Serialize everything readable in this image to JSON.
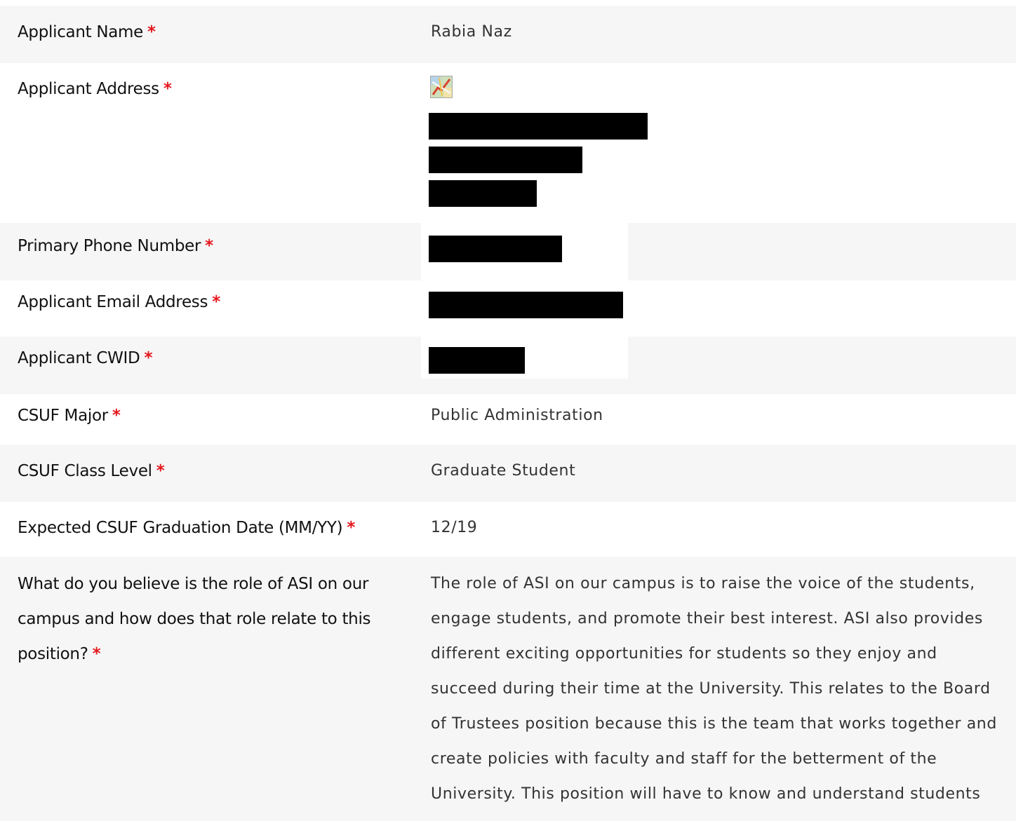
{
  "form": {
    "required_marker": "*",
    "fields": [
      {
        "label": "Applicant Name",
        "value": "Rabia Naz"
      },
      {
        "label": "Applicant Address",
        "value": ""
      },
      {
        "label": "Primary Phone Number",
        "value": ""
      },
      {
        "label": "Applicant Email Address",
        "value": ""
      },
      {
        "label": "Applicant CWID",
        "value": ""
      },
      {
        "label": "CSUF Major",
        "value": "Public Administration"
      },
      {
        "label": "CSUF Class Level",
        "value": "Graduate Student"
      },
      {
        "label": "Expected CSUF Graduation Date (MM/YY)",
        "value": "12/19"
      },
      {
        "label": "What do you believe is the role of ASI on our campus and how does that role relate to this position?",
        "value": "The role of ASI on our campus is to raise the voice of the students, engage students, and promote their best interest. ASI also provides different exciting opportunities for students so they enjoy and succeed during their time at the University. This relates to the Board of Trustees position because this is the team that works together and create policies with faculty and staff for the betterment of the University. This position will have to know and understand students"
      }
    ]
  },
  "icons": {
    "address_map": "map-icon"
  },
  "colors": {
    "required": "#e4171d",
    "label_text": "#111111",
    "value_text": "#333333",
    "redaction": "#000000",
    "row_shade": "#f6f6f6"
  }
}
